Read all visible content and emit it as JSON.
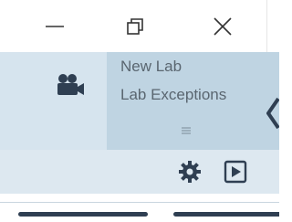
{
  "window": {
    "minimize_icon": "minimize-icon",
    "restore_icon": "restore-icon",
    "close_icon": "close-icon"
  },
  "header": {
    "video_icon": "video-camera-icon",
    "lab_title": "New Lab",
    "lab_subtitle": "Lab Exceptions",
    "menu_icon": "hamburger-menu-icon"
  },
  "toolbar": {
    "settings_icon": "gear-icon",
    "play_icon": "play-icon"
  },
  "colors": {
    "header_bg": "#d6e4ee",
    "lab_panel_bg": "#bfd4e2",
    "toolbar_bg": "#dde8f0",
    "icon_dark": "#2f3f52"
  }
}
